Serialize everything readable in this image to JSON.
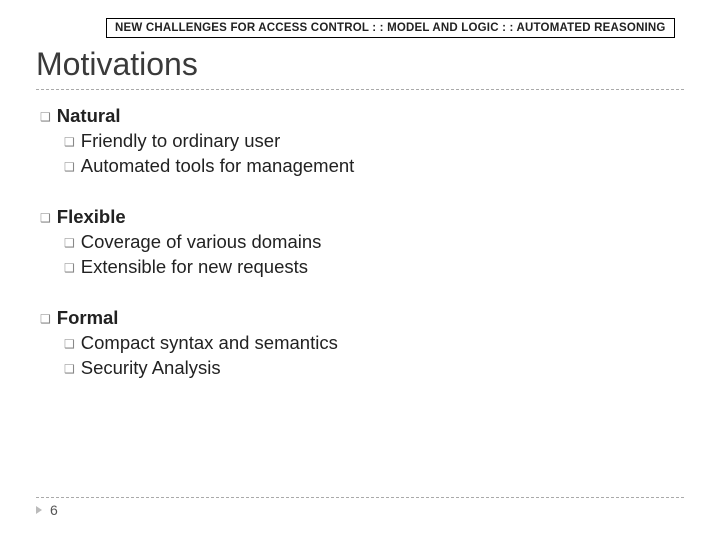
{
  "header": "NEW CHALLENGES FOR ACCESS CONTROL : : MODEL AND LOGIC : : AUTOMATED REASONING",
  "title": "Motivations",
  "groups": [
    {
      "head": "Natural",
      "items": [
        "Friendly to ordinary user",
        "Automated tools for management"
      ]
    },
    {
      "head": "Flexible",
      "items": [
        "Coverage of various domains",
        "Extensible for new requests"
      ]
    },
    {
      "head": "Formal",
      "items": [
        "Compact syntax and semantics",
        "Security Analysis"
      ]
    }
  ],
  "page_number": "6",
  "bullet_glyph": "❑"
}
